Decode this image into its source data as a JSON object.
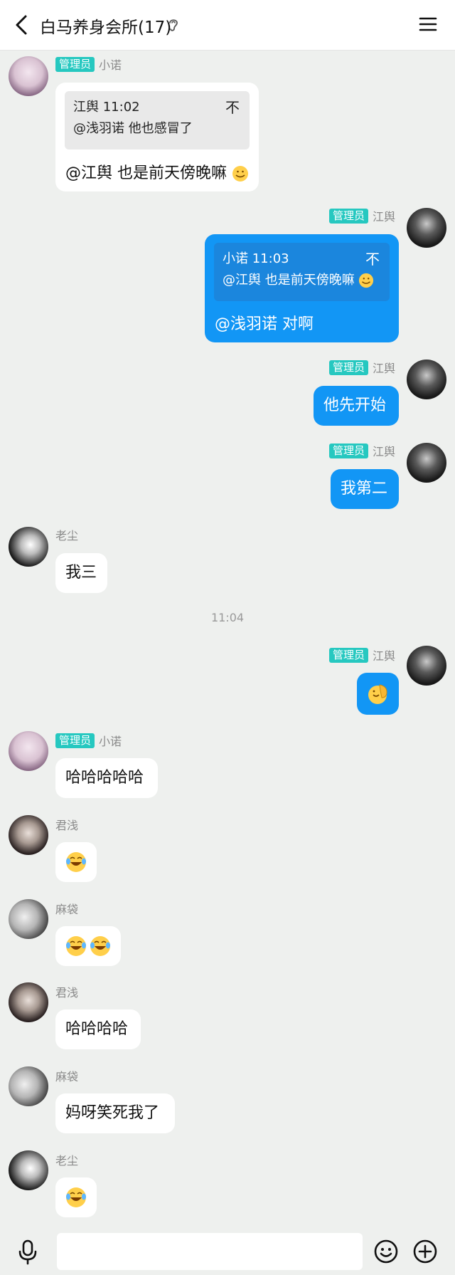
{
  "header": {
    "title": "白马养身会所(17)"
  },
  "labels": {
    "admin_badge": "管理员"
  },
  "time_divider": "11:04",
  "messages": [
    {
      "sender": "小诺",
      "quote_header": "江舆 11:02",
      "quote_text": "@浅羽诺 他也感冒了",
      "quote_pin": "不",
      "text": "@江舆 也是前天傍晚嘛"
    },
    {
      "sender": "江舆",
      "quote_header": "小诺 11:03",
      "quote_text": "@江舆 也是前天傍晚嘛",
      "quote_pin": "不",
      "text": "@浅羽诺 对啊"
    },
    {
      "sender": "江舆",
      "text": "他先开始"
    },
    {
      "sender": "江舆",
      "text": "我第二"
    },
    {
      "sender": "老尘",
      "text": "我三"
    },
    {
      "sender": "江舆",
      "text": "",
      "emoji": "hand-pat-emoji"
    },
    {
      "sender": "小诺",
      "text": "哈哈哈哈哈"
    },
    {
      "sender": "君浅",
      "text": "",
      "emoji": "laugh-cry-emoji"
    },
    {
      "sender": "麻袋",
      "text": "",
      "emoji": "laugh-cry-emoji-x2"
    },
    {
      "sender": "君浅",
      "text": "哈哈哈哈"
    },
    {
      "sender": "麻袋",
      "text": "妈呀笑死我了"
    },
    {
      "sender": "老尘",
      "text": "",
      "emoji": "laugh-cry-emoji"
    }
  ],
  "input_bar": {
    "icons": [
      "microphone-icon",
      "emoji-face-icon",
      "plus-icon"
    ],
    "placeholder": ""
  },
  "colors": {
    "outgoing_bubble": "#1296f5",
    "admin_badge": "#26c8c0",
    "background": "#eef0ee"
  }
}
